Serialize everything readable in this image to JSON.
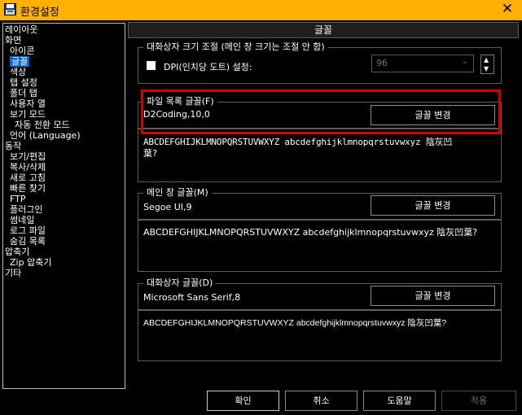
{
  "window": {
    "title": "환경설정",
    "close_glyph": "✕"
  },
  "sidebar": {
    "items": [
      {
        "label": "레이아웃",
        "indent": 1,
        "selected": false
      },
      {
        "label": "화면",
        "indent": 1,
        "selected": false
      },
      {
        "label": "아이콘",
        "indent": 2,
        "selected": false
      },
      {
        "label": "글꼴",
        "indent": 2,
        "selected": true
      },
      {
        "label": "색상",
        "indent": 2,
        "selected": false
      },
      {
        "label": "탭 설정",
        "indent": 2,
        "selected": false
      },
      {
        "label": "폴더 탭",
        "indent": 2,
        "selected": false
      },
      {
        "label": "사용자 열",
        "indent": 2,
        "selected": false
      },
      {
        "label": "보기 모드",
        "indent": 2,
        "selected": false
      },
      {
        "label": "자동 전환 모드",
        "indent": 3,
        "selected": false
      },
      {
        "label": "언어 (Language)",
        "indent": 2,
        "selected": false
      },
      {
        "label": "동작",
        "indent": 1,
        "selected": false
      },
      {
        "label": "보기/편집",
        "indent": 2,
        "selected": false
      },
      {
        "label": "복사/삭제",
        "indent": 2,
        "selected": false
      },
      {
        "label": "새로 고침",
        "indent": 2,
        "selected": false
      },
      {
        "label": "빠른 찾기",
        "indent": 2,
        "selected": false
      },
      {
        "label": "FTP",
        "indent": 2,
        "selected": false
      },
      {
        "label": "플러그인",
        "indent": 2,
        "selected": false
      },
      {
        "label": "썸네일",
        "indent": 2,
        "selected": false
      },
      {
        "label": "로그 파일",
        "indent": 2,
        "selected": false
      },
      {
        "label": "숨김 목록",
        "indent": 2,
        "selected": false
      },
      {
        "label": "압축기",
        "indent": 1,
        "selected": false
      },
      {
        "label": "Zip 압축기",
        "indent": 2,
        "selected": false
      },
      {
        "label": "기타",
        "indent": 1,
        "selected": false
      }
    ]
  },
  "panel": {
    "header": "글꼴",
    "size_group": {
      "legend": "대화상자 크기 조절 (메인 창 크기는 조절 안 함)",
      "dpi_label": "DPI(인치당 도트) 설정:",
      "dpi_value": "96",
      "dpi_checked": true
    },
    "file_list_font": {
      "legend": "파일 목록 글꼴(F)",
      "current": "D2Coding,10,0",
      "button": "글꼴 변경",
      "sample": "ABCDEFGHIJKLMNOPQRSTUVWXYZ abcdefghijklmnopqrstuvwxyz 陰灰凹\n葉?"
    },
    "main_window_font": {
      "legend": "메인 창 글꼴(M)",
      "current": "Segoe UI,9",
      "button": "글꼴 변경",
      "sample": "ABCDEFGHIJKLMNOPQRSTUVWXYZ abcdefghijklmnopqrstuvwxyz 陰灰凹葉?"
    },
    "dialog_font": {
      "legend": "대화상자 글꼴(D)",
      "current": "Microsoft Sans Serif,8",
      "button": "글꼴 변경",
      "sample": "ABCDEFGHIJKLMNOPQRSTUVWXYZ abcdefghijklmnopqrstuvwxyz 陰灰凹葉?"
    }
  },
  "footer": {
    "ok": "확인",
    "cancel": "취소",
    "help": "도움말",
    "apply": "적용"
  },
  "colors": {
    "titlebar": "#ffb000",
    "selection": "#0066cc",
    "highlight": "#d40000"
  }
}
